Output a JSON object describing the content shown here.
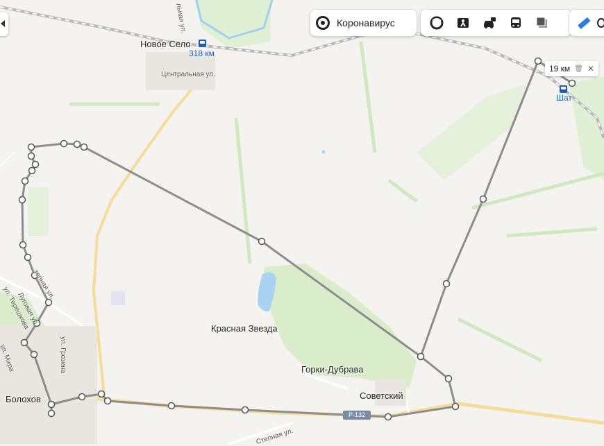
{
  "map": {
    "labels": {
      "novoe_selo": "Новое Село",
      "km_318": "318 км",
      "tsentralnaya": "Центральная ул.",
      "lnaya": "льная ул.",
      "krasnaya_zvezda": "Красная Звезда",
      "gorki_dubrava": "Горки-Дубрава",
      "sovetsky": "Советский",
      "bolohov": "Болохов",
      "stepnaya": "Степная ул.",
      "lugovaya": "Луговая ул.",
      "telnaya": "тепная ул.",
      "tereshkova": "ул. Терешкова",
      "groznaya": "ул. Грозина",
      "mira": "ул. Мира",
      "shat": "Шат",
      "road_code": "Р-132"
    },
    "route_distance": "19 км",
    "colors": {
      "route": "#8c8c8c",
      "road_major": "#f6dc9a",
      "forest": "#c9e6b6",
      "water": "#a9d3f0",
      "accent": "#1b5fb5"
    }
  },
  "toolbar": {
    "coronavirus_label": "Коронавирус",
    "icons": [
      "layers-icon",
      "panorama-icon",
      "traffic-icon",
      "transit-icon",
      "map-type-icon",
      "ruler-icon"
    ]
  }
}
